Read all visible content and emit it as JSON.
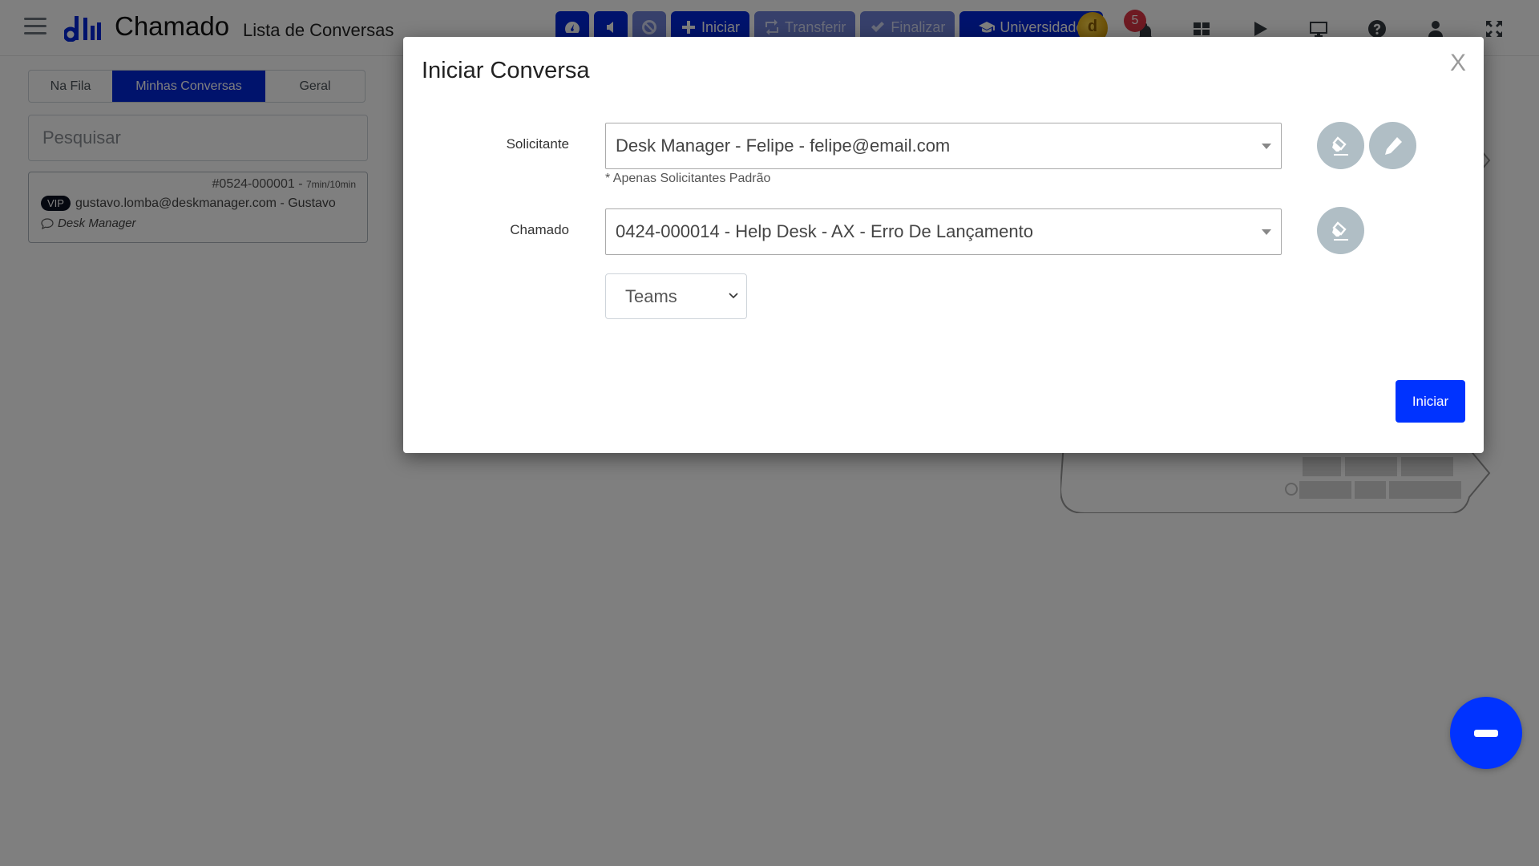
{
  "header": {
    "app_title": "Chamado",
    "page_subtitle": "Lista de Conversas",
    "toolbar": [
      {
        "id": "dashboard",
        "icon": "dashboard-icon",
        "label": "",
        "disabled": false
      },
      {
        "id": "sound",
        "icon": "speaker-icon",
        "label": "",
        "disabled": false
      },
      {
        "id": "block",
        "icon": "ban-icon",
        "label": "",
        "disabled": true
      },
      {
        "id": "iniciar",
        "icon": "plus-icon",
        "label": "Iniciar",
        "disabled": false
      },
      {
        "id": "transferir",
        "icon": "retweet-icon",
        "label": "Transferir",
        "disabled": true
      },
      {
        "id": "finalizar",
        "icon": "check-icon",
        "label": "Finalizar",
        "disabled": true
      },
      {
        "id": "universidade",
        "icon": "graduation-cap-icon",
        "label": "Universidade",
        "disabled": false
      }
    ],
    "coin_glyph": "d",
    "notification_count": "5"
  },
  "sidebar": {
    "tabs": [
      {
        "label": "Na Fila",
        "active": false
      },
      {
        "label": "Minhas Conversas",
        "active": true
      },
      {
        "label": "Geral",
        "active": false
      }
    ],
    "search_placeholder": "Pesquisar",
    "conversations": [
      {
        "ticket": "#0524-000001",
        "separator": " - ",
        "timer": "7min/10min",
        "vip_label": "VIP",
        "contact": "gustavo.lomba@deskmanager.com - Gustavo",
        "company": "Desk Manager"
      }
    ]
  },
  "modal": {
    "title": "Iniciar Conversa",
    "close_label": "X",
    "solicitante": {
      "label": "Solicitante",
      "value": "Desk Manager - Felipe - felipe@email.com",
      "helper": "* Apenas Solicitantes Padrão"
    },
    "chamado": {
      "label": "Chamado",
      "value": "0424-000014 - Help Desk - AX - Erro De Lançamento"
    },
    "channel": {
      "value": "Teams"
    },
    "submit_label": "Iniciar"
  },
  "colors": {
    "brand": "#0026d9",
    "primary_button": "#0033ff",
    "round_button": "#b0bec5",
    "badge": "#dc3545"
  }
}
